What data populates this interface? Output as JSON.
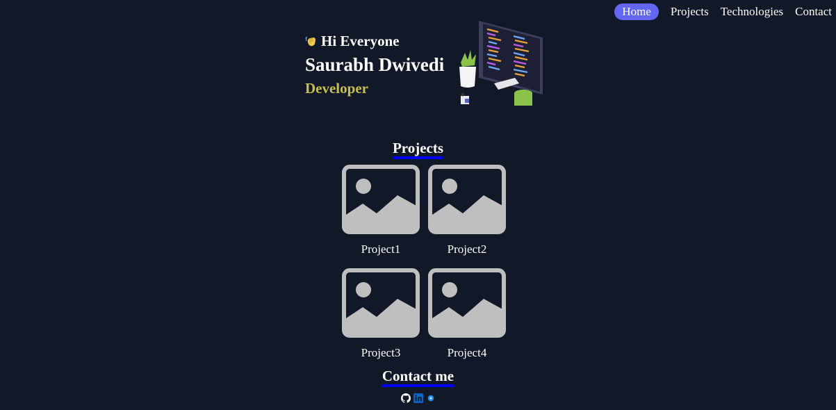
{
  "nav": {
    "items": [
      {
        "label": "Home",
        "active": true
      },
      {
        "label": "Projects"
      },
      {
        "label": "Technologies"
      },
      {
        "label": "Contact"
      }
    ]
  },
  "hero": {
    "greeting": "Hi Everyone",
    "name": "Saurabh Dwivedi",
    "role": "Developer",
    "illustration": "developer-desk-illustration"
  },
  "projects": {
    "title": "Projects",
    "items": [
      {
        "label": "Project1",
        "icon": "image-placeholder-icon"
      },
      {
        "label": "Project2",
        "icon": "image-placeholder-icon"
      },
      {
        "label": "Project3",
        "icon": "image-placeholder-icon"
      },
      {
        "label": "Project4",
        "icon": "image-placeholder-icon"
      }
    ]
  },
  "contact": {
    "title": "Contact me",
    "links": [
      {
        "icon": "github-icon"
      },
      {
        "icon": "linkedin-icon"
      },
      {
        "icon": "dot-icon"
      }
    ]
  },
  "colors": {
    "background": "#111827",
    "accent": "#6366f1",
    "role": "#c7c04f",
    "underline": "#0000ff"
  }
}
